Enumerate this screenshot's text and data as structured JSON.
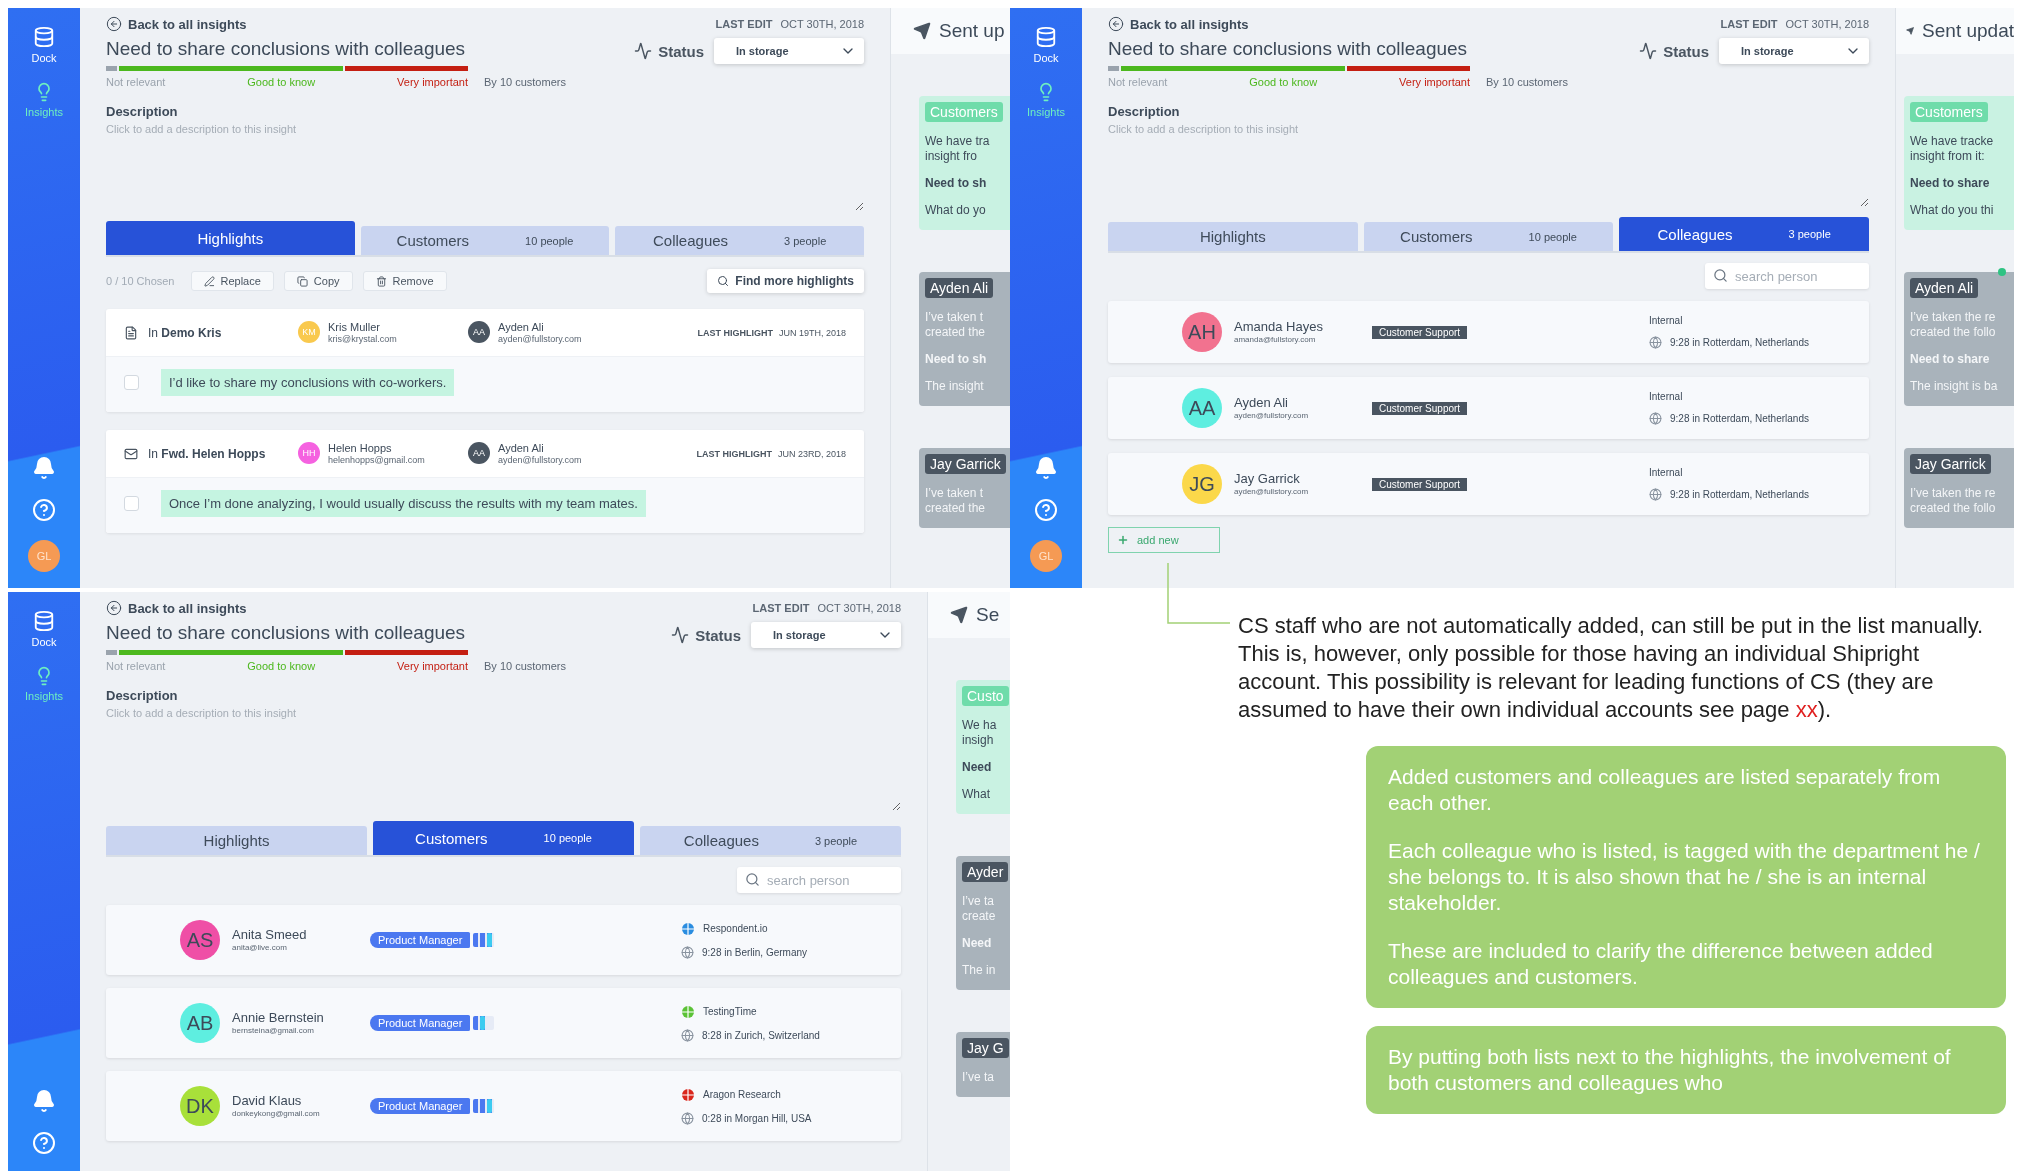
{
  "screens": [
    {
      "sidebar": {
        "items": [
          {
            "label": "Dock",
            "kind": "dock",
            "selected": false
          },
          {
            "label": "Insights",
            "kind": "insights",
            "selected": true
          }
        ],
        "avatar": "GL"
      },
      "back_link": "Back to all insights",
      "last_edit_label": "LAST EDIT",
      "last_edit_date": "OCT 30TH, 2018",
      "title": "Need to share conclusions with colleagues",
      "importance": [
        {
          "label": "Not relevant",
          "color": "#9aa3ad"
        },
        {
          "label": "Good to know",
          "color": "#4cb81e"
        },
        {
          "label": "Very important",
          "color": "#c41f12"
        }
      ],
      "reach": "By 10 customers",
      "status_label": "Status",
      "status_value": "In storage",
      "description_label": "Description",
      "description_placeholder": "Click to add a description to this insight",
      "tabs": [
        {
          "label": "Highlights",
          "selected": true
        },
        {
          "label": "Customers",
          "count": "10 people",
          "selected": false
        },
        {
          "label": "Colleagues",
          "count": "3 people",
          "selected": false
        }
      ],
      "panel": {
        "kind": "highlights",
        "chosen": "0 / 10 Chosen",
        "actions": [
          {
            "label": "Replace",
            "kind": "replace"
          },
          {
            "label": "Copy",
            "kind": "copy"
          },
          {
            "label": "Remove",
            "kind": "remove"
          }
        ],
        "find_more": "Find more highlights",
        "items": [
          {
            "kind": "document",
            "source": "In **Demo Kris**",
            "customer": {
              "initials": "KM",
              "name": "Kris Muller",
              "email": "kris@krystal.com",
              "color": "#f9c94e"
            },
            "colleague": {
              "initials": "AA",
              "name": "Ayden Ali",
              "email": "ayden@fullstory.com",
              "color": "#4a5561"
            },
            "last_label": "LAST HIGHLIGHT",
            "last_date": "JUN 19TH, 2018",
            "quote": "I’d like to share my conclusions with co-workers.",
            "checked": false
          },
          {
            "kind": "mail",
            "source": "In **Fwd. Helen Hopps**",
            "customer": {
              "initials": "HH",
              "name": "Helen Hopps",
              "email": "helenhopps@gmail.com",
              "color": "#f562e0"
            },
            "colleague": {
              "initials": "AA",
              "name": "Ayden Ali",
              "email": "ayden@fullstory.com",
              "color": "#4a5561"
            },
            "last_label": "LAST HIGHLIGHT",
            "last_date": "JUN 23RD, 2018",
            "quote": "Once I’m done analyzing, I would usually discuss the results with my team mates.",
            "checked": false
          }
        ]
      },
      "feed": {
        "title": "Sent up",
        "cards": [
          {
            "kind": "customers",
            "tag": "Customers",
            "paragraphs": [
              {
                "lines": [
                  "We have tra",
                  "insight fro"
                ],
                "bold": false
              },
              {
                "lines": [
                  "Need to sh"
                ],
                "bold": true
              },
              {
                "lines": [
                  "What do yo"
                ],
                "bold": false
              }
            ]
          },
          {
            "kind": "colleague",
            "tag": "Ayden Ali",
            "paragraphs": [
              {
                "lines": [
                  "I’ve taken t",
                  "created the"
                ],
                "bold": false
              },
              {
                "lines": [
                  "Need to sh"
                ],
                "bold": true
              },
              {
                "lines": [
                  "The insight"
                ],
                "bold": false
              }
            ]
          },
          {
            "kind": "colleague",
            "tag": "Jay Garrick",
            "paragraphs": [
              {
                "lines": [
                  "I’ve taken t",
                  "created the"
                ],
                "bold": false
              }
            ]
          }
        ]
      }
    },
    {
      "sidebar": {
        "items": [
          {
            "label": "Dock",
            "kind": "dock",
            "selected": false
          },
          {
            "label": "Insights",
            "kind": "insights",
            "selected": true
          }
        ],
        "avatar": "GL"
      },
      "back_link": "Back to all insights",
      "last_edit_label": "LAST EDIT",
      "last_edit_date": "OCT 30TH, 2018",
      "title": "Need to share conclusions with colleagues",
      "importance": [
        {
          "label": "Not relevant",
          "color": "#9aa3ad"
        },
        {
          "label": "Good to know",
          "color": "#4cb81e"
        },
        {
          "label": "Very important",
          "color": "#c41f12"
        }
      ],
      "reach": "By 10 customers",
      "status_label": "Status",
      "status_value": "In storage",
      "description_label": "Description",
      "description_placeholder": "Click to add a description to this insight",
      "tabs": [
        {
          "label": "Highlights",
          "selected": false
        },
        {
          "label": "Customers",
          "count": "10 people",
          "selected": false
        },
        {
          "label": "Colleagues",
          "count": "3 people",
          "selected": true
        }
      ],
      "panel": {
        "kind": "people",
        "search_placeholder": "search person",
        "add_new": "add new",
        "people": [
          {
            "initials": "AH",
            "name": "Amanda Hayes",
            "email": "amanda@fullstory.com",
            "color": "#f2728f",
            "tag": "Customer Support",
            "kind": "colleague",
            "source": {
              "name": "Internal",
              "kind": "internal"
            },
            "location": "9:28 in Rotterdam, Netherlands"
          },
          {
            "initials": "AA",
            "name": "Ayden Ali",
            "email": "ayden@fullstory.com",
            "color": "#5eeee0",
            "tag": "Customer Support",
            "kind": "colleague",
            "source": {
              "name": "Internal",
              "kind": "internal"
            },
            "location": "9:28 in Rotterdam, Netherlands"
          },
          {
            "initials": "JG",
            "name": "Jay Garrick",
            "email": "ayden@fullstory.com",
            "color": "#fbd84a",
            "tag": "Customer Support",
            "kind": "colleague",
            "source": {
              "name": "Internal",
              "kind": "internal"
            },
            "location": "9:28 in Rotterdam, Netherlands"
          }
        ]
      },
      "feed": {
        "title": "Sent updat",
        "cards": [
          {
            "kind": "customers",
            "tag": "Customers",
            "online": false,
            "paragraphs": [
              {
                "lines": [
                  "We have tracke",
                  "insight from it:"
                ],
                "bold": false
              },
              {
                "lines": [
                  "Need to share"
                ],
                "bold": true
              },
              {
                "lines": [
                  "What do you thi"
                ],
                "bold": false
              }
            ]
          },
          {
            "kind": "colleague",
            "tag": "Ayden Ali",
            "online": true,
            "paragraphs": [
              {
                "lines": [
                  "I’ve taken the re",
                  "created the follo"
                ],
                "bold": false
              },
              {
                "lines": [
                  "Need to share"
                ],
                "bold": true
              },
              {
                "lines": [
                  "The insight is ba"
                ],
                "bold": false
              }
            ]
          },
          {
            "kind": "colleague",
            "tag": "Jay Garrick",
            "online": false,
            "paragraphs": [
              {
                "lines": [
                  "I’ve taken the re",
                  "created the follo"
                ],
                "bold": false
              }
            ]
          }
        ]
      }
    },
    {
      "sidebar": {
        "items": [
          {
            "label": "Dock",
            "kind": "dock",
            "selected": false
          },
          {
            "label": "Insights",
            "kind": "insights",
            "selected": true
          }
        ]
      },
      "back_link": "Back to all insights",
      "last_edit_label": "LAST EDIT",
      "last_edit_date": "OCT 30TH, 2018",
      "title": "Need to share conclusions with colleagues",
      "importance": [
        {
          "label": "Not relevant",
          "color": "#9aa3ad"
        },
        {
          "label": "Good to know",
          "color": "#4cb81e"
        },
        {
          "label": "Very important",
          "color": "#c41f12"
        }
      ],
      "reach": "By 10 customers",
      "status_label": "Status",
      "status_value": "In storage",
      "description_label": "Description",
      "description_placeholder": "Click to add a description to this insight",
      "tabs": [
        {
          "label": "Highlights",
          "selected": false
        },
        {
          "label": "Customers",
          "count": "10 people",
          "selected": true
        },
        {
          "label": "Colleagues",
          "count": "3 people",
          "selected": false
        }
      ],
      "panel": {
        "kind": "people",
        "search_placeholder": "search person",
        "people": [
          {
            "initials": "AS",
            "name": "Anita Smeed",
            "email": "anita@live.com",
            "color": "#ef4fa6",
            "tag": "Product Manager",
            "kind": "customer",
            "level": 1,
            "source": {
              "name": "Respondent.io",
              "kind": "panel",
              "color": "#2a8de0"
            },
            "location": "9:28 in Berlin, Germany"
          },
          {
            "initials": "AB",
            "name": "Annie Bernstein",
            "email": "bernsteina@gmail.com",
            "color": "#5eeee0",
            "tag": "Product Manager",
            "kind": "customer",
            "level": 0.67,
            "source": {
              "name": "TestingTime",
              "kind": "panel",
              "color": "#5bc236"
            },
            "location": "8:28 in Zurich, Switzerland"
          },
          {
            "initials": "DK",
            "name": "David Klaus",
            "email": "donkeykong@gmail.com",
            "color": "#a8e03a",
            "tag": "Product Manager",
            "kind": "customer",
            "level": 1,
            "source": {
              "name": "Aragon Research",
              "kind": "panel",
              "color": "#d9261c"
            },
            "location": "0:28 in Morgan Hill, USA"
          }
        ]
      },
      "feed": {
        "title": "Se",
        "cards": [
          {
            "kind": "customers",
            "tag": "Custo",
            "paragraphs": [
              {
                "lines": [
                  "We ha",
                  "insigh"
                ],
                "bold": false
              },
              {
                "lines": [
                  "Need"
                ],
                "bold": true
              },
              {
                "lines": [
                  "What"
                ],
                "bold": false
              }
            ]
          },
          {
            "kind": "colleague",
            "tag": "Ayder",
            "paragraphs": [
              {
                "lines": [
                  "I’ve ta",
                  "create"
                ],
                "bold": false
              },
              {
                "lines": [
                  "Need"
                ],
                "bold": true
              },
              {
                "lines": [
                  "The in"
                ],
                "bold": false
              }
            ]
          },
          {
            "kind": "colleague",
            "tag": "Jay G",
            "paragraphs": [
              {
                "lines": [
                  "I’ve ta"
                ],
                "bold": false
              }
            ]
          }
        ]
      }
    }
  ],
  "annotation": {
    "note": {
      "text": "CS staff who are not automatically added, can still be put in the list manually. This is, however, only possible for those having an individual Shipright account. This possibility is relevant for leading functions of CS (they are assumed to have their own individual accounts see page ",
      "reference": "xx",
      "suffix": ")."
    },
    "callouts": [
      {
        "paragraphs": [
          "Added customers and colleagues are listed separately from each other.",
          "Each colleague who is listed, is tagged with the department he / she belongs to. It is also shown that he / she is an internal stakeholder.",
          "These are included to clarify the difference between added colleagues and customers."
        ]
      },
      {
        "paragraphs": [
          "By putting both lists next to the highlights, the involvement of both customers and colleagues who"
        ]
      }
    ]
  }
}
